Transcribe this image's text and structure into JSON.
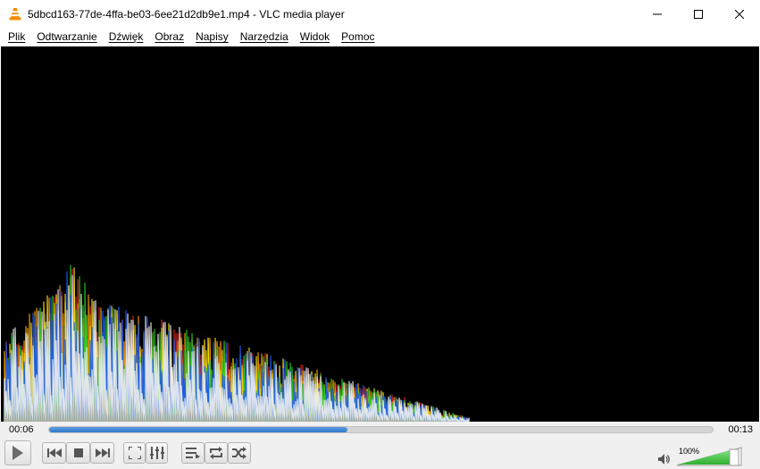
{
  "window": {
    "title": "5dbcd163-77de-4ffa-be03-6ee21d2db9e1.mp4 - VLC media player",
    "app_icon": "vlc-cone-icon"
  },
  "menu": {
    "items": [
      {
        "label": "Plik"
      },
      {
        "label": "Odtwarzanie"
      },
      {
        "label": "Dźwięk"
      },
      {
        "label": "Obraz"
      },
      {
        "label": "Napisy"
      },
      {
        "label": "Narzędzia"
      },
      {
        "label": "Widok"
      },
      {
        "label": "Pomoc"
      }
    ]
  },
  "player": {
    "current_time": "00:06",
    "total_time": "00:13",
    "progress_fraction": 0.45,
    "volume_label": "100%",
    "volume_fraction": 1.0
  },
  "colors": {
    "accent": "#2f77c9",
    "volume_green": "#3fc43f",
    "video_bg": "#000000"
  },
  "icons": {
    "play": "play-icon",
    "previous": "previous-icon",
    "stop": "stop-icon",
    "next": "next-icon",
    "fullscreen": "fullscreen-icon",
    "extended_settings": "equalizer-icon",
    "playlist": "playlist-icon",
    "loop": "loop-icon",
    "shuffle": "shuffle-icon",
    "volume": "speaker-icon"
  }
}
